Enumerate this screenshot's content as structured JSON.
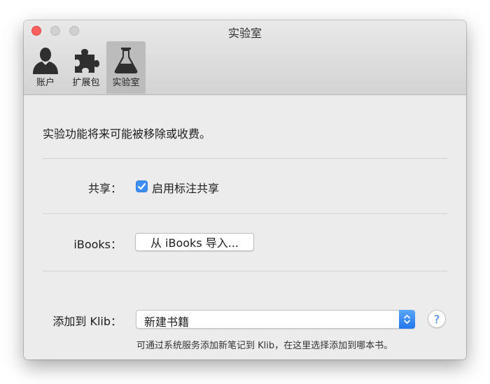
{
  "window": {
    "title": "实验室"
  },
  "toolbar": {
    "tabs": [
      {
        "label": "账户",
        "icon": "user-icon",
        "selected": false
      },
      {
        "label": "扩展包",
        "icon": "puzzle-icon",
        "selected": false
      },
      {
        "label": "实验室",
        "icon": "flask-icon",
        "selected": true
      }
    ]
  },
  "content": {
    "intro": "实验功能将来可能被移除或收费。",
    "share": {
      "label": "共享：",
      "checkbox_label": "启用标注共享",
      "checked": true
    },
    "ibooks": {
      "label": "iBooks：",
      "button_label": "从 iBooks 导入..."
    },
    "klib": {
      "label": "添加到 Klib：",
      "selected_value": "新建书籍",
      "help_label": "?",
      "hint": "可通过系统服务添加新笔记到 Klib，在这里选择添加到哪本书。"
    }
  },
  "colors": {
    "accent": "#3d8ff7",
    "close_button": "#fc605c",
    "window_background": "#ececec"
  }
}
